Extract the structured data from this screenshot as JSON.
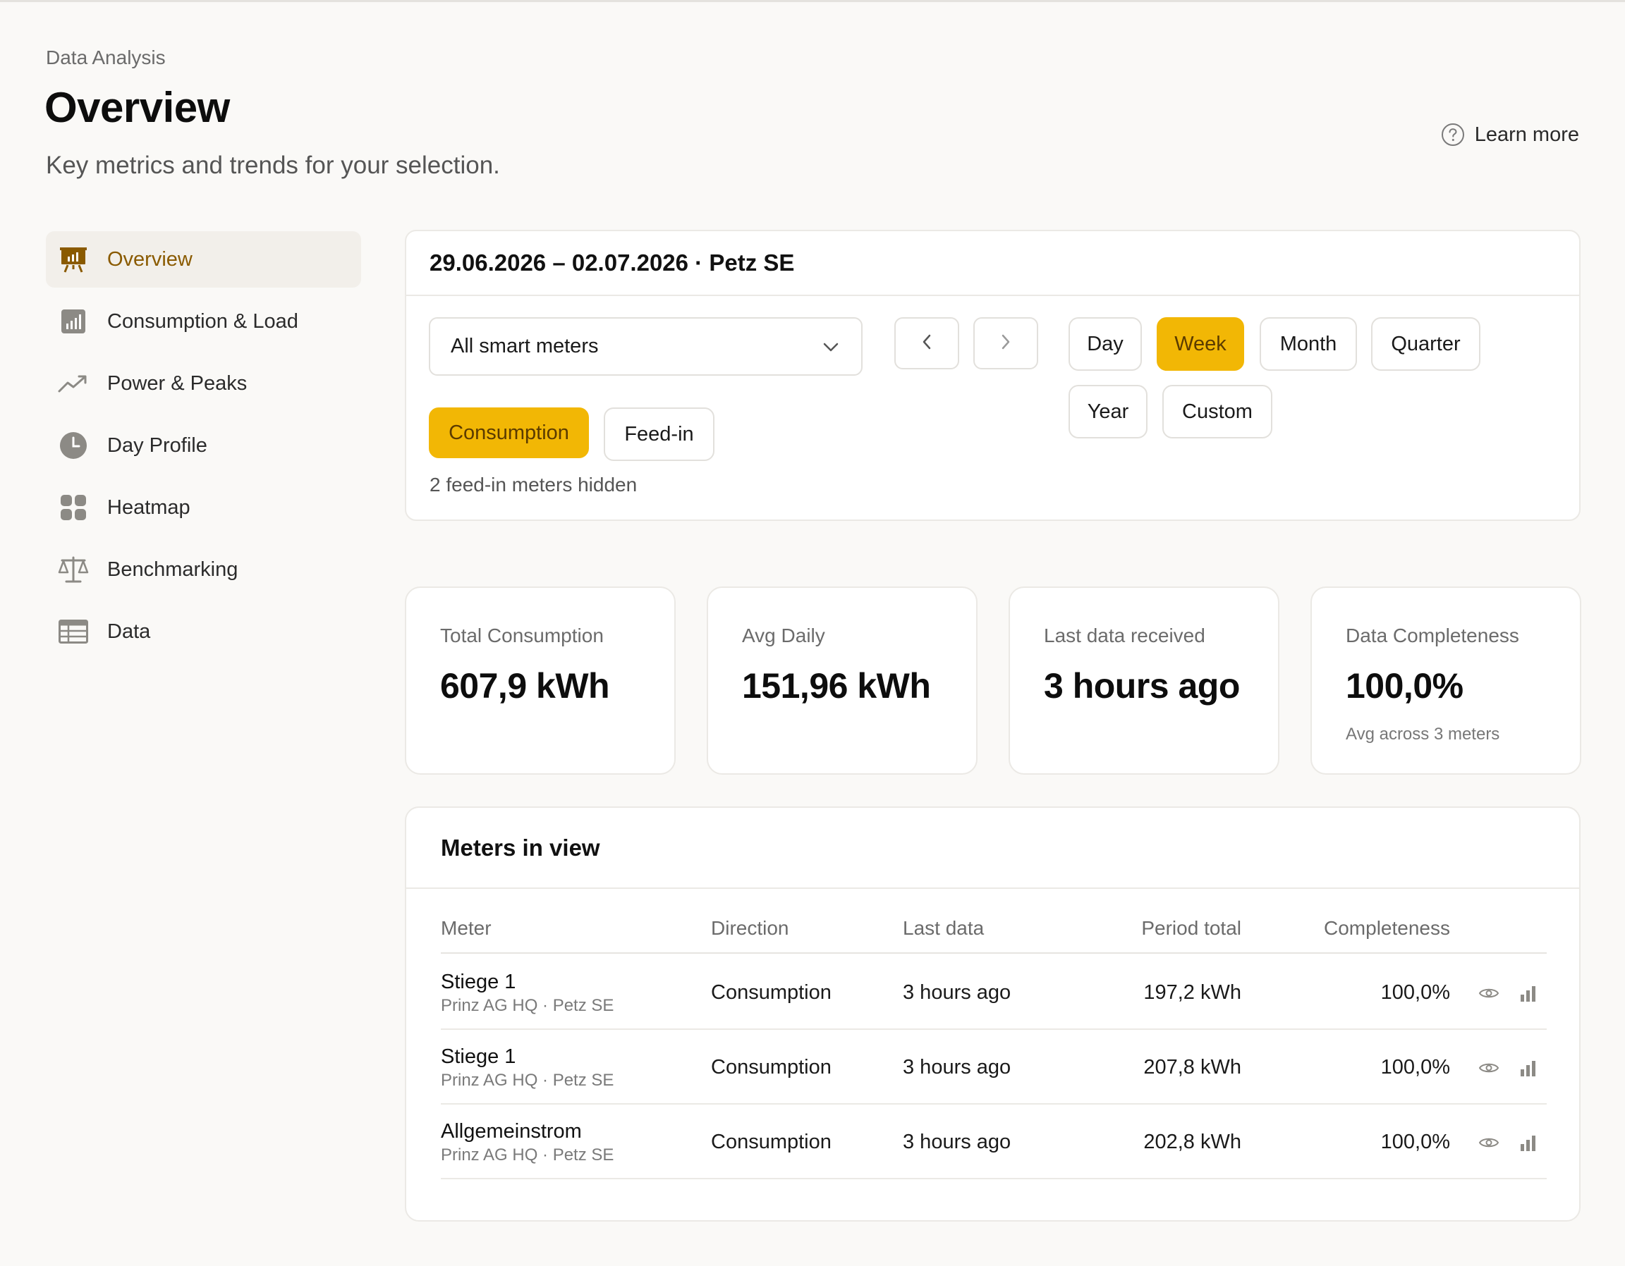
{
  "header": {
    "breadcrumb": "Data Analysis",
    "title": "Overview",
    "subtitle": "Key metrics and trends for your selection.",
    "learn_more": "Learn more"
  },
  "sidebar": {
    "items": [
      {
        "label": "Overview",
        "icon": "presentation-chart-icon",
        "active": true
      },
      {
        "label": "Consumption & Load",
        "icon": "bar-chart-icon"
      },
      {
        "label": "Power & Peaks",
        "icon": "trending-up-icon"
      },
      {
        "label": "Day Profile",
        "icon": "clock-icon"
      },
      {
        "label": "Heatmap",
        "icon": "grid-icon"
      },
      {
        "label": "Benchmarking",
        "icon": "scale-icon"
      },
      {
        "label": "Data",
        "icon": "table-icon"
      }
    ]
  },
  "filters": {
    "range_title": "29.06.2026 – 02.07.2026 · Petz SE",
    "meter_select": "All smart meters",
    "periods": [
      "Day",
      "Week",
      "Month",
      "Quarter",
      "Year",
      "Custom"
    ],
    "active_period": "Week",
    "directions": [
      "Consumption",
      "Feed-in"
    ],
    "active_direction": "Consumption",
    "hidden_note": "2 feed-in meters hidden"
  },
  "kpis": [
    {
      "label": "Total Consumption",
      "value": "607,9 kWh",
      "sub": ""
    },
    {
      "label": "Avg Daily",
      "value": "151,96 kWh",
      "sub": ""
    },
    {
      "label": "Last data received",
      "value": "3 hours ago",
      "sub": ""
    },
    {
      "label": "Data Completeness",
      "value": "100,0%",
      "sub": "Avg across 3 meters"
    }
  ],
  "meters": {
    "title": "Meters in view",
    "columns": [
      "Meter",
      "Direction",
      "Last data",
      "Period total",
      "Completeness"
    ],
    "rows": [
      {
        "name": "Stiege 1",
        "location": "Prinz AG HQ · Petz SE",
        "direction": "Consumption",
        "last": "3 hours ago",
        "total": "197,2 kWh",
        "completeness": "100,0%"
      },
      {
        "name": "Stiege 1",
        "location": "Prinz AG HQ · Petz SE",
        "direction": "Consumption",
        "last": "3 hours ago",
        "total": "207,8 kWh",
        "completeness": "100,0%"
      },
      {
        "name": "Allgemeinstrom",
        "location": "Prinz AG HQ · Petz SE",
        "direction": "Consumption",
        "last": "3 hours ago",
        "total": "202,8 kWh",
        "completeness": "100,0%"
      }
    ]
  },
  "colors": {
    "accent": "#f2b705",
    "accent_text": "#5b3b00",
    "active_nav_text": "#8a5a00",
    "icon_gray": "#8c8a85"
  }
}
